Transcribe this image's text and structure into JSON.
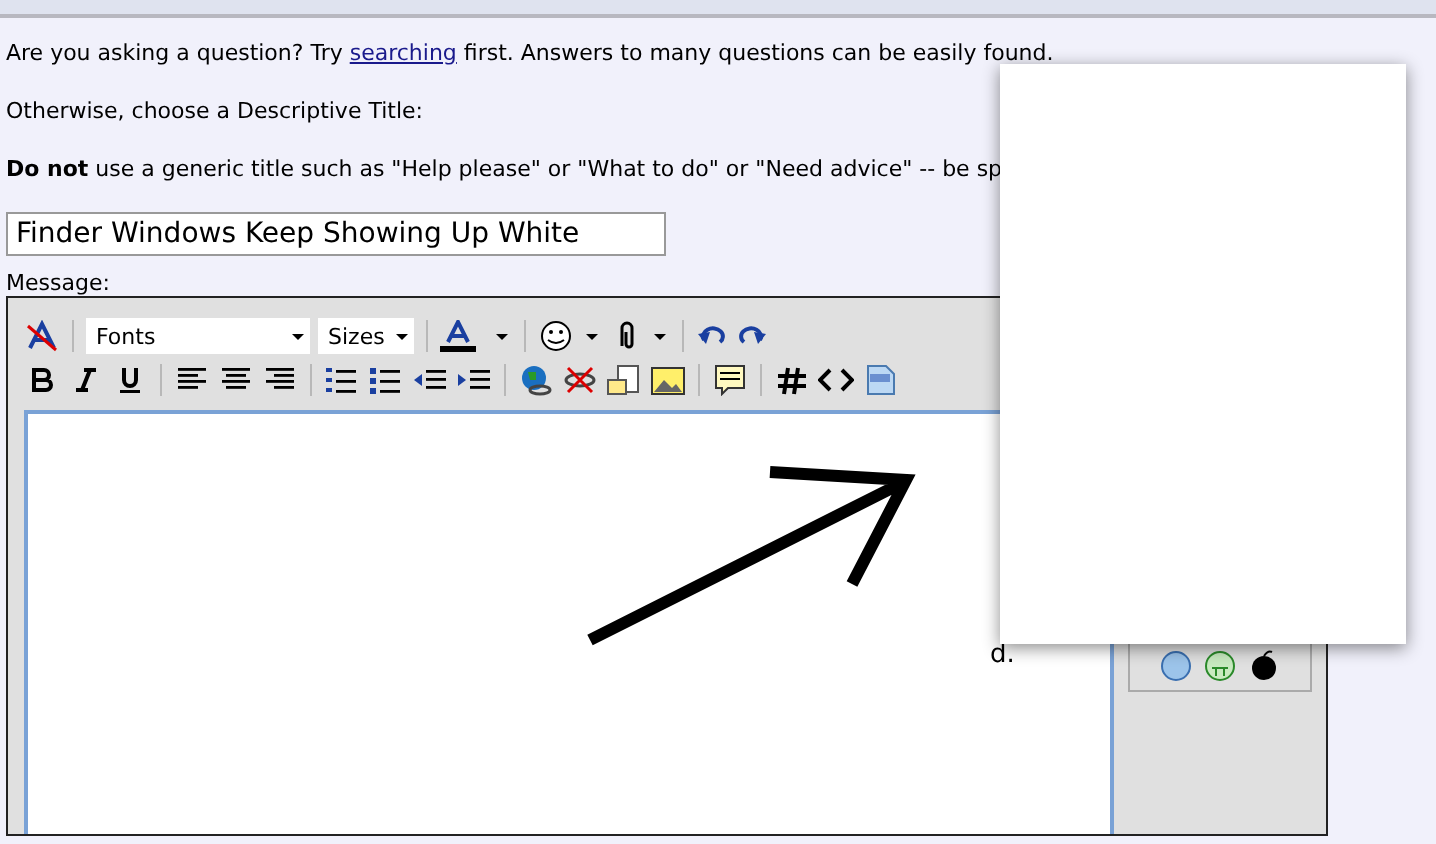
{
  "intro": {
    "before": "Are you asking a question? Try ",
    "link": "searching",
    "after": " first. Answers to many questions can be easily found."
  },
  "instruction": "Otherwise, choose a Descriptive Title:",
  "warning": "**Do not** use a generic title such as \"Help please\" or \"What to do\" or \"Need advice\" -- be sp",
  "title_field": {
    "value": "Finder Windows Keep Showing Up White"
  },
  "message_label": "Message:",
  "toolbar": {
    "font_select": "Fonts",
    "size_select": "Sizes"
  },
  "peek_text": [
    "d."
  ]
}
